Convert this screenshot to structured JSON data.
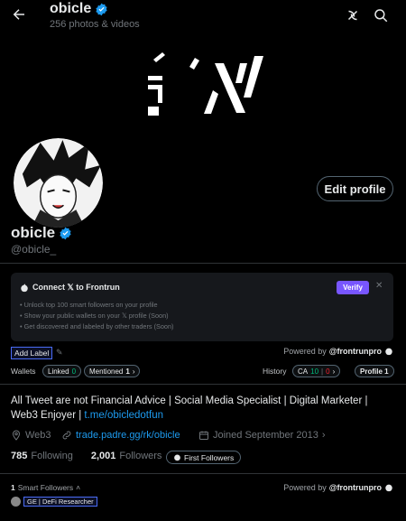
{
  "header": {
    "name": "obicle",
    "subtitle": "256 photos & videos"
  },
  "profile": {
    "name": "obicle",
    "handle": "@obicle_",
    "edit_label": "Edit profile",
    "banner_text": "ʼʼא"
  },
  "frontrun": {
    "title": "Connect 𝕏 to Frontrun",
    "bullets": [
      "• Unlock top 100 smart followers on your profile",
      "• Show your public wallets on your 𝕏 profile (Soon)",
      "• Get discovered and labeled by other traders (Soon)"
    ],
    "verify_label": "Verify",
    "close": "✕",
    "add_label": "Add Label",
    "powered_prefix": "Powered by",
    "powered_brand": "@frontrunpro",
    "wallets_label": "Wallets",
    "linked_label": "Linked",
    "linked_count": "0",
    "mentioned_label": "Mentioned",
    "mentioned_count": "1",
    "history_label": "History",
    "ca_label": "CA",
    "ca_green": "10",
    "ca_red": "0",
    "profile_pill": "Profile 1"
  },
  "bio": {
    "text": "All Tweet are not Financial Advice | Social Media Specialist | Digital Marketer | Web3 Enjoyer | ",
    "link": "t.me/obicledotfun"
  },
  "meta": {
    "location": "Web3",
    "website": "trade.padre.gg/rk/obicle",
    "joined": "Joined September 2013"
  },
  "stats": {
    "following_count": "785",
    "following_label": "Following",
    "followers_count": "2,001",
    "followers_label": "Followers",
    "first_followers_label": "First Followers"
  },
  "smart": {
    "count": "1",
    "label": "Smart Followers",
    "powered_prefix": "Powered by",
    "powered_brand": "@frontrunpro",
    "tag": "GE | DeFi Researcher"
  }
}
